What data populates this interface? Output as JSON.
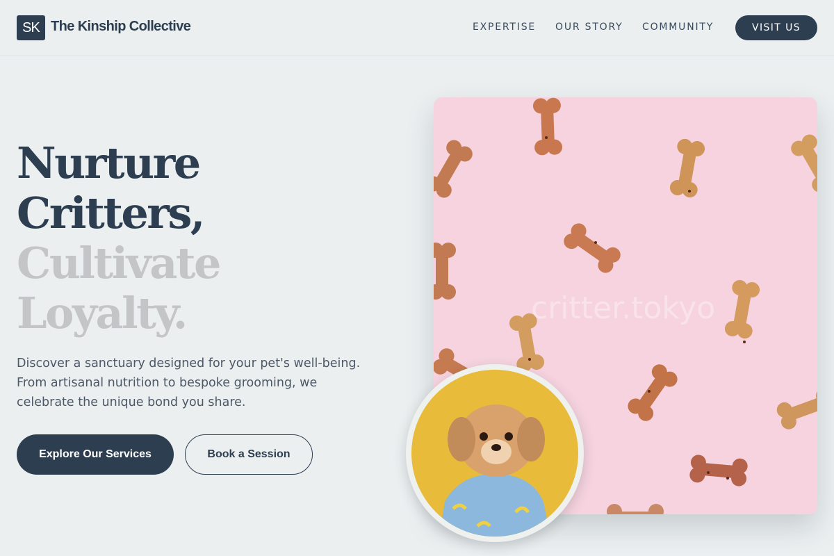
{
  "brand": {
    "badge": "SK",
    "name": "The Kinship Collective"
  },
  "nav": {
    "links": [
      "EXPERTISE",
      "OUR STORY",
      "COMMUNITY"
    ],
    "cta": "VISIT US"
  },
  "hero": {
    "headline": [
      "Nurture",
      "Critters,",
      "Cultivate",
      "Loyalty."
    ],
    "description": "Discover a sanctuary designed for your pet's well-being. From artisanal nutrition to bespoke grooming, we celebrate the unique bond you share.",
    "primary_button": "Explore Our Services",
    "secondary_button": "Book a Session",
    "image_watermark": "critter.tokyo"
  },
  "colors": {
    "accent": "#2c3e50",
    "background": "#ebeff0",
    "muted_headline": "#c3c5c7",
    "image_bg": "#f6d3df",
    "avatar_bg": "#e8bb3a"
  },
  "icons": {
    "hero_image": "dog-biscuits-photo",
    "avatar": "dog-portrait-photo"
  }
}
